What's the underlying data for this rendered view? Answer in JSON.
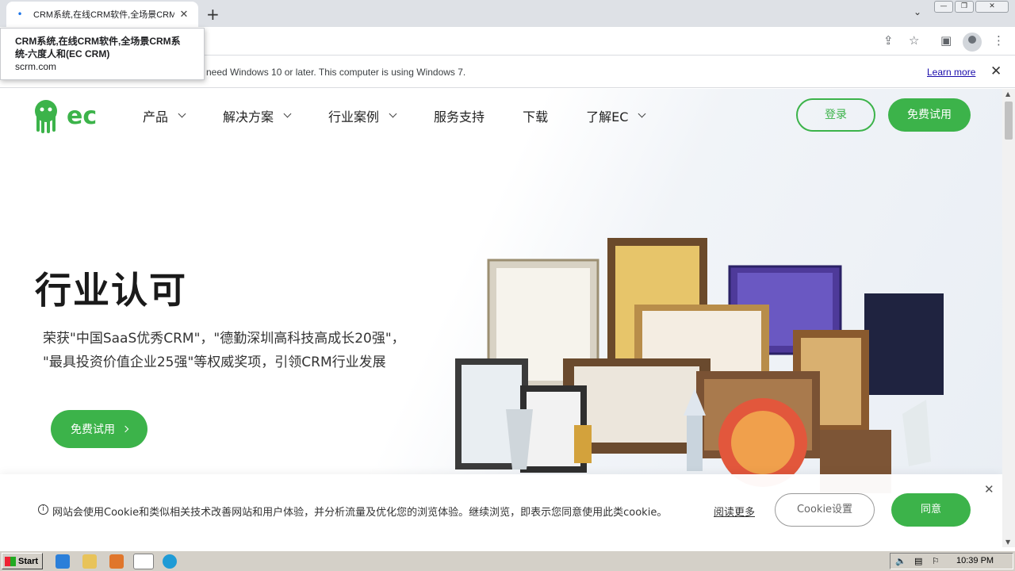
{
  "browser": {
    "tab_title": "CRM系统,在线CRM软件,全场景CRM",
    "tooltip_title": "CRM系统,在线CRM软件,全场景CRM系统-六度人和(EC CRM)",
    "tooltip_domain": "scrm.com",
    "infobar_message": "l need Windows 10 or later. This computer is using Windows 7.",
    "infobar_link": "Learn more"
  },
  "nav": {
    "items": [
      {
        "label": "产品",
        "dropdown": true
      },
      {
        "label": "解决方案",
        "dropdown": true
      },
      {
        "label": "行业案例",
        "dropdown": true
      },
      {
        "label": "服务支持",
        "dropdown": false
      },
      {
        "label": "下载",
        "dropdown": false
      },
      {
        "label": "了解EC",
        "dropdown": true
      }
    ],
    "login_label": "登录",
    "trial_label": "免费试用"
  },
  "hero": {
    "title": "行业认可",
    "subtitle_line1": "荣获\"中国SaaS优秀CRM\"，\"德勤深圳高科技高成长20强\"，",
    "subtitle_line2": "\"最具投资价值企业25强\"等权威奖项，引领CRM行业发展",
    "button_label": "免费试用"
  },
  "cookie": {
    "text": "网站会使用Cookie和类似相关技术改善网站和用户体验，并分析流量及优化您的浏览体验。继续浏览，即表示您同意使用此类cookie。",
    "more_link": "阅读更多",
    "settings_label": "Cookie设置",
    "agree_label": "同意"
  },
  "taskbar": {
    "start_label": "Start",
    "clock": "10:39 PM"
  },
  "colors": {
    "brand_green": "#3cb34a"
  }
}
